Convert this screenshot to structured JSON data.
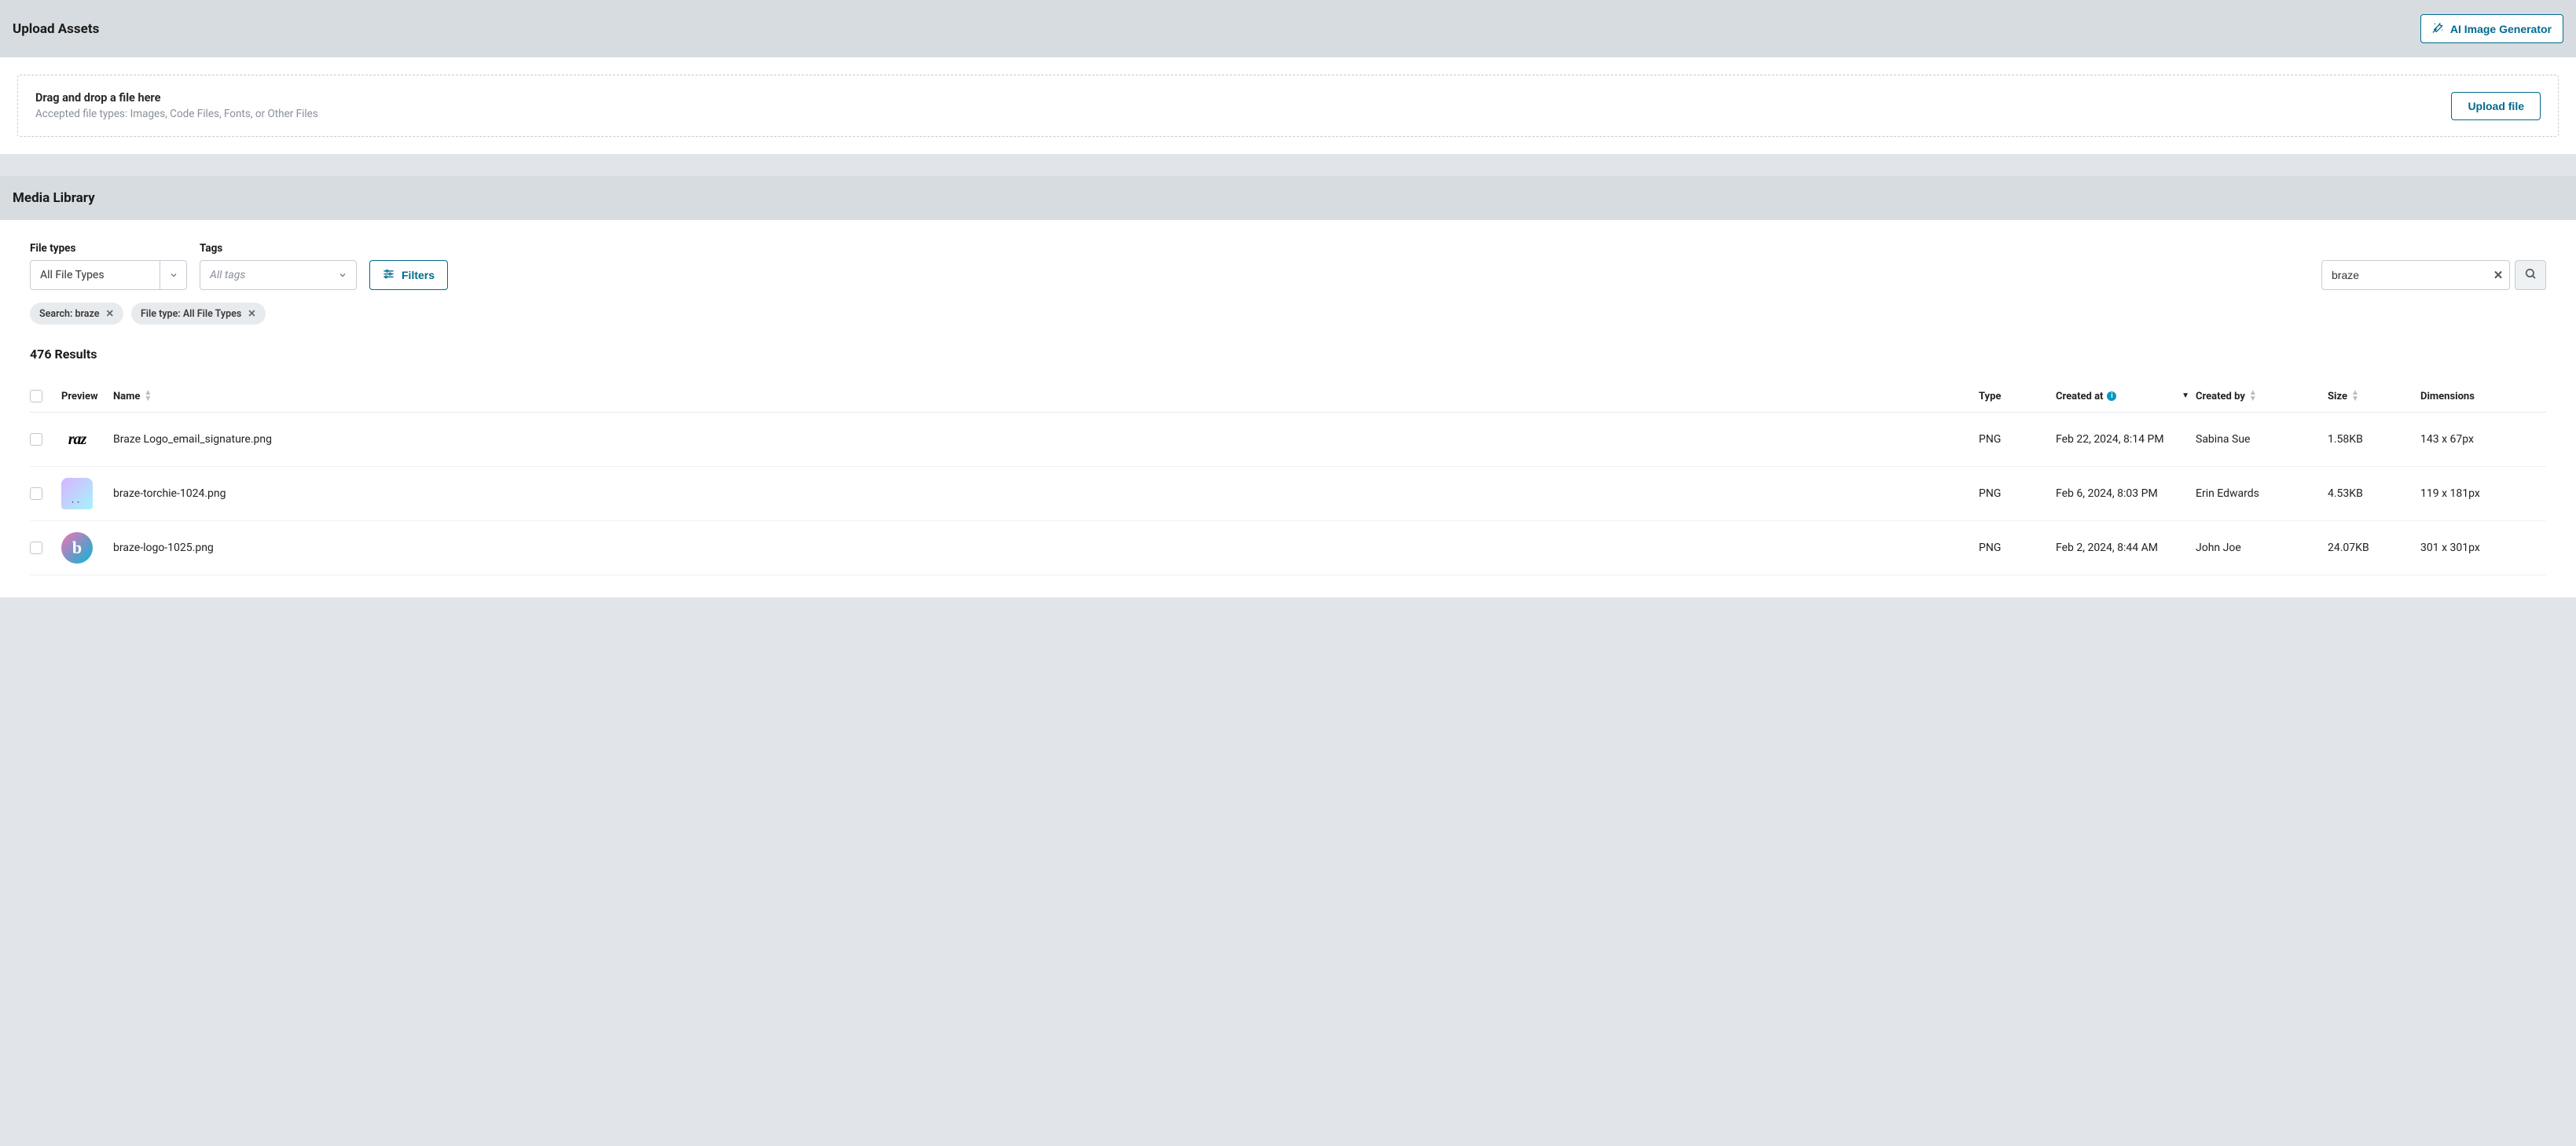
{
  "upload": {
    "title": "Upload Assets",
    "ai_button": "AI Image Generator",
    "dz_title": "Drag and drop a file here",
    "dz_sub": "Accepted file types: Images, Code Files, Fonts, or Other Files",
    "upload_btn": "Upload file"
  },
  "library": {
    "title": "Media Library",
    "filters": {
      "filetypes_label": "File types",
      "filetypes_value": "All File Types",
      "tags_label": "Tags",
      "tags_placeholder": "All tags",
      "filters_btn": "Filters"
    },
    "search": {
      "value": "braze"
    },
    "chips": [
      {
        "label": "Search: braze"
      },
      {
        "label": "File type: All File Types"
      }
    ],
    "results_count": "476 Results",
    "columns": {
      "preview": "Preview",
      "name": "Name",
      "type": "Type",
      "created_at": "Created at",
      "created_by": "Created by",
      "size": "Size",
      "dimensions": "Dimensions"
    },
    "rows": [
      {
        "preview_class": "pv-braze-text",
        "preview_text": "raz",
        "name": "Braze Logo_email_signature.png",
        "type": "PNG",
        "created_at": "Feb 22, 2024, 8:14 PM",
        "created_by": "Sabina Sue",
        "size": "1.58KB",
        "dimensions": "143 x 67px"
      },
      {
        "preview_class": "pv-torchie",
        "preview_text": "",
        "name": "braze-torchie-1024.png",
        "type": "PNG",
        "created_at": "Feb 6, 2024, 8:03 PM",
        "created_by": "Erin Edwards",
        "size": "4.53KB",
        "dimensions": "119 x 181px"
      },
      {
        "preview_class": "pv-logo",
        "preview_text": "b",
        "name": "braze-logo-1025.png",
        "type": "PNG",
        "created_at": "Feb 2, 2024, 8:44 AM",
        "created_by": "John Joe",
        "size": "24.07KB",
        "dimensions": "301 x 301px"
      }
    ]
  }
}
